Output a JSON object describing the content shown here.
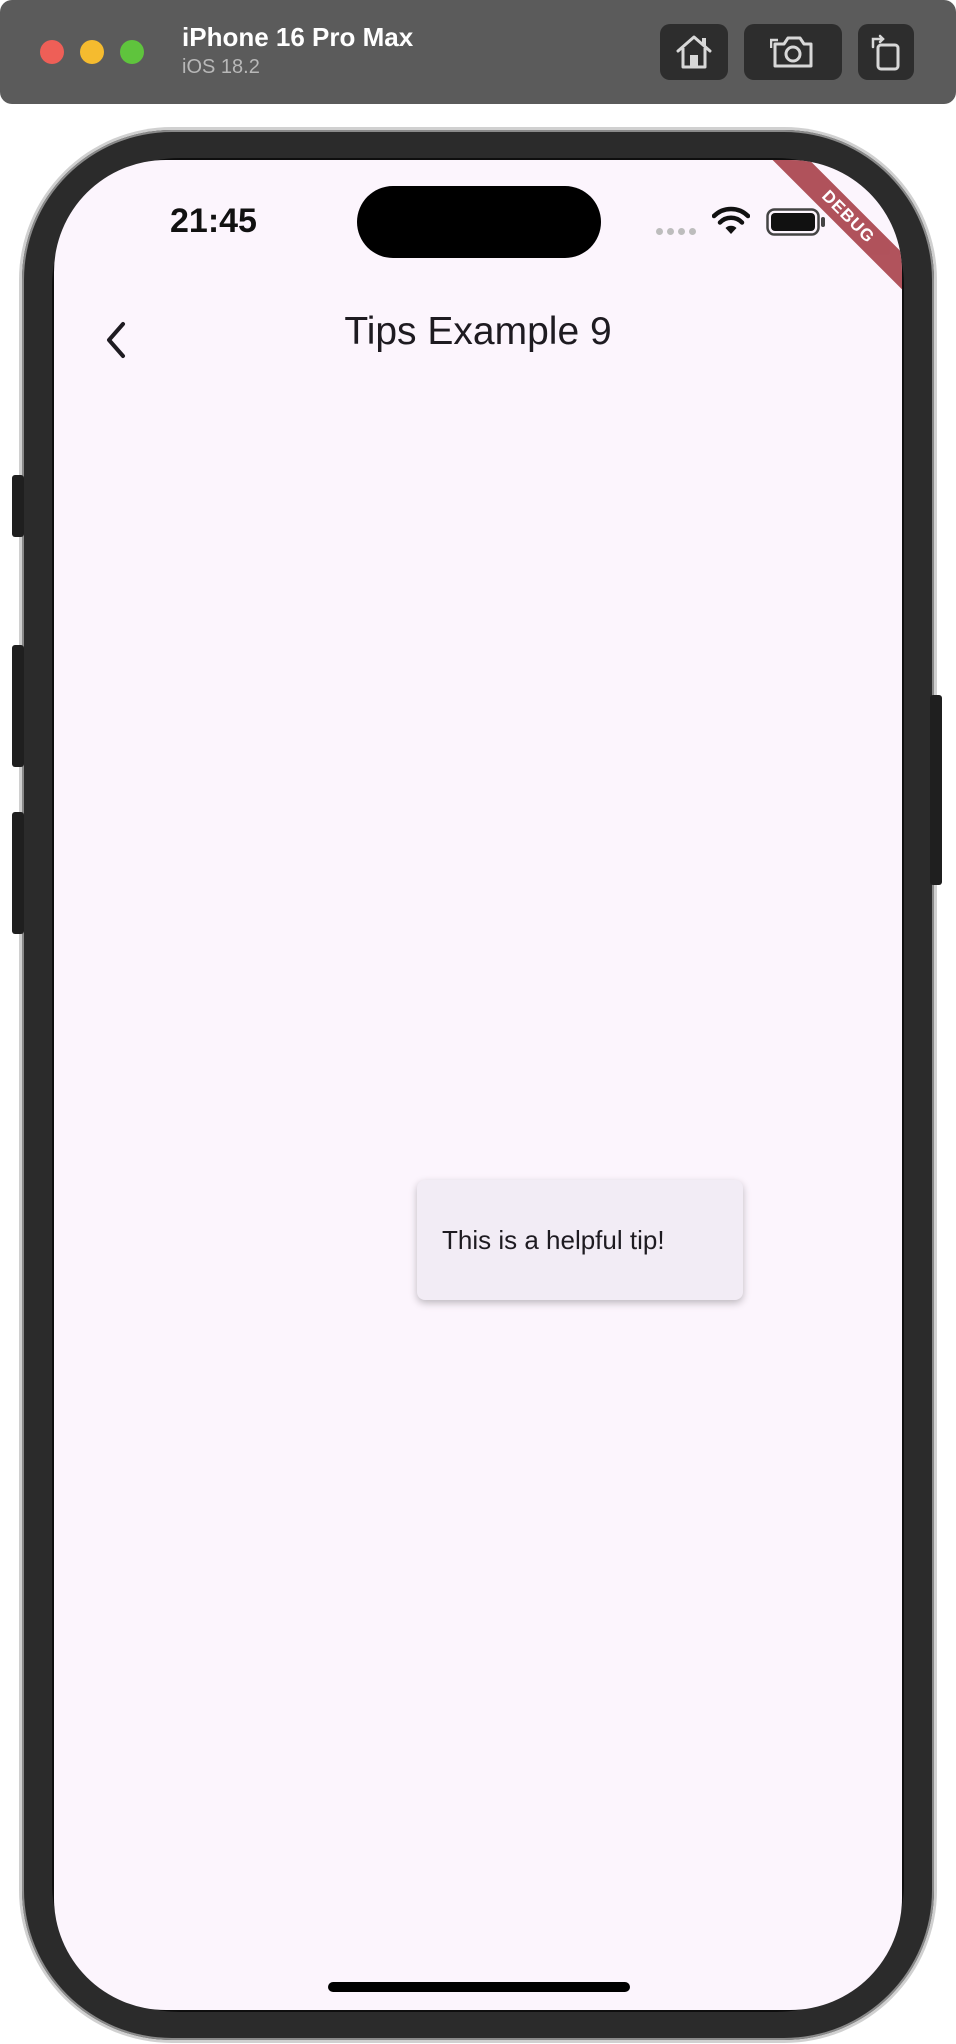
{
  "simulator": {
    "device_name": "iPhone 16 Pro Max",
    "os_version": "iOS 18.2",
    "toolbar_icons": [
      "home-icon",
      "screenshot-icon",
      "rotate-icon"
    ]
  },
  "status_bar": {
    "time": "21:45",
    "icons": [
      "cellular-dots-icon",
      "wifi-icon",
      "battery-icon"
    ]
  },
  "debug_banner": {
    "label": "DEBUG",
    "color": "#a3363f"
  },
  "app_bar": {
    "title": "Tips Example 9",
    "back_icon": "chevron-left-icon"
  },
  "tooltip": {
    "message": "This is a helpful tip!"
  },
  "colors": {
    "screen_background": "#fcf5fd",
    "tooltip_background": "#f2ecf5",
    "title_bar": "#5b5b5b"
  }
}
